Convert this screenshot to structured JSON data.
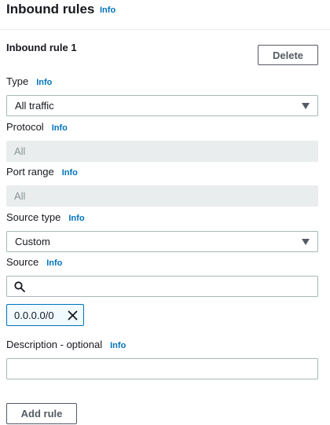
{
  "header": {
    "title": "Inbound rules",
    "info": "Info"
  },
  "rule": {
    "title": "Inbound rule 1",
    "delete_label": "Delete",
    "type": {
      "label": "Type",
      "info": "Info",
      "value": "All traffic"
    },
    "protocol": {
      "label": "Protocol",
      "info": "Info",
      "value": "All"
    },
    "port_range": {
      "label": "Port range",
      "info": "Info",
      "value": "All"
    },
    "source_type": {
      "label": "Source type",
      "info": "Info",
      "value": "Custom"
    },
    "source": {
      "label": "Source",
      "info": "Info",
      "search_value": "",
      "token": "0.0.0.0/0"
    },
    "description": {
      "label": "Description - optional",
      "info": "Info",
      "value": ""
    }
  },
  "add_rule_label": "Add rule",
  "icons": {
    "caret": "caret-down-icon",
    "search": "search-icon",
    "remove": "close-icon"
  }
}
